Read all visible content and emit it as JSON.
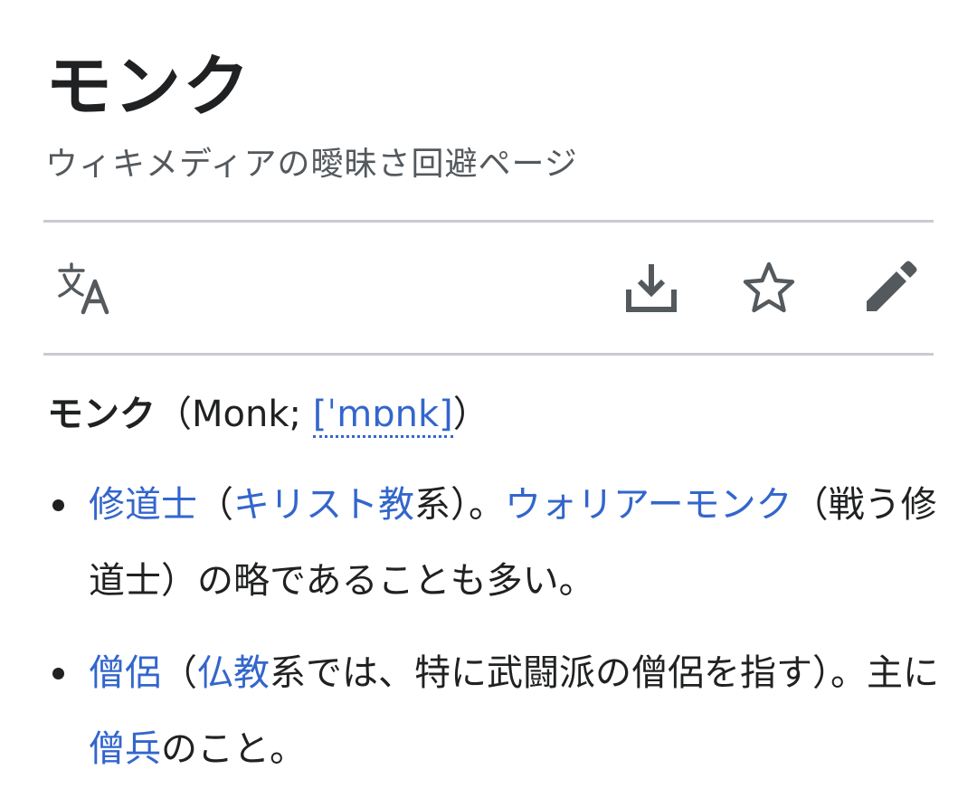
{
  "header": {
    "title": "モンク",
    "subtitle": "ウィキメディアの曖昧さ回避ページ"
  },
  "toolbar": {
    "icons": [
      "language-icon",
      "download-icon",
      "star-icon",
      "edit-icon"
    ]
  },
  "lead": {
    "term": "モンク",
    "open_paren": "（",
    "english": "Monk; ",
    "ipa": "[ˈmɒnk]",
    "close_paren": "）"
  },
  "items": [
    {
      "l1": "修道士",
      "t1": "（",
      "l2": "キリスト教",
      "t2": "系）。",
      "l3": "ウォリアーモンク",
      "t3": "（戦う修道士）の略であることも多い。"
    },
    {
      "l1": "僧侶",
      "t1": "（",
      "l2": "仏教",
      "t2": "系では、特に武闘派の僧侶を指す）。主に",
      "l3": "僧兵",
      "t3": "のこと。"
    }
  ],
  "colors": {
    "text": "#202122",
    "subtle_text": "#54595d",
    "link": "#3366cc",
    "divider": "#c8ccd1",
    "icon": "#54595d"
  }
}
